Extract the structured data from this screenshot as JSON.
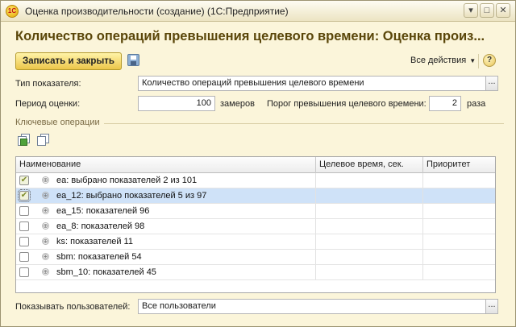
{
  "window": {
    "title": "Оценка производительности (создание)  (1С:Предприятие)",
    "logo": "1С"
  },
  "form": {
    "heading": "Количество операций превышения целевого времени: Оценка произ..."
  },
  "toolbar": {
    "save_close_label": "Записать и закрыть",
    "all_actions_label": "Все действия",
    "help_label": "?"
  },
  "fields": {
    "indicator_type_label": "Тип показателя:",
    "indicator_type_value": "Количество операций превышения целевого времени",
    "period_label": "Период оценки:",
    "period_value": "100",
    "period_unit": "замеров",
    "threshold_label": "Порог превышения целевого времени:",
    "threshold_value": "2",
    "threshold_unit": "раза",
    "show_users_label": "Показывать пользователей:",
    "show_users_value": "Все пользователи",
    "dots": "..."
  },
  "key_operations": {
    "group_title": "Ключевые операции",
    "columns": [
      "Наименование",
      "Целевое время, сек.",
      "Приоритет"
    ],
    "rows": [
      {
        "name": "ea: выбрано показателей 2 из 101",
        "checked": true,
        "selected": false
      },
      {
        "name": "ea_12: выбрано показателей 5 из 97",
        "checked": true,
        "selected": true
      },
      {
        "name": "ea_15: показателей 96",
        "checked": false,
        "selected": false
      },
      {
        "name": "ea_8: показателей 98",
        "checked": false,
        "selected": false
      },
      {
        "name": "ks: показателей 11",
        "checked": false,
        "selected": false
      },
      {
        "name": "sbm: показателей 54",
        "checked": false,
        "selected": false
      },
      {
        "name": "sbm_10: показателей 45",
        "checked": false,
        "selected": false
      }
    ]
  },
  "icons": {
    "close": "close-icon",
    "maximize": "maximize-icon",
    "menu": "menu-icon",
    "expand": "⊕",
    "check": "✔"
  },
  "colors": {
    "window_bg": "#fbf5da",
    "heading": "#5a4609",
    "primary_button": "#ecc64a",
    "selected_row": "#cfe2f8"
  }
}
